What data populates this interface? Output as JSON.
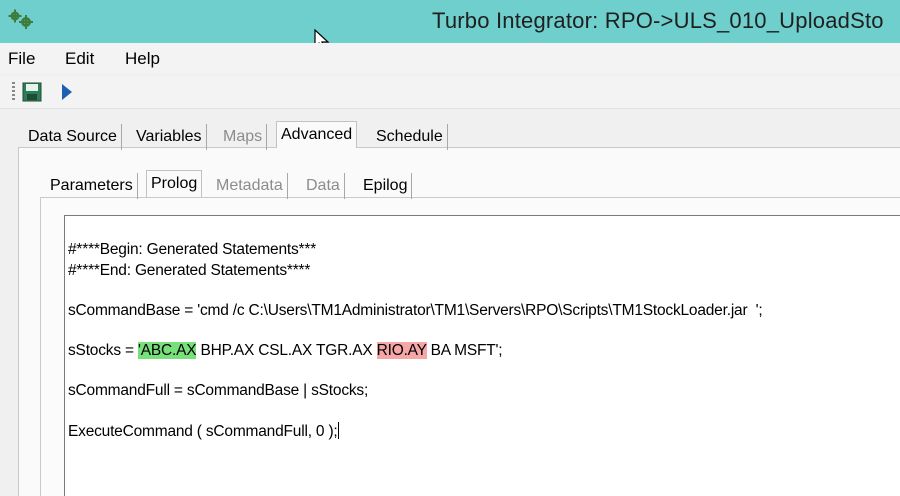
{
  "window": {
    "title": "Turbo Integrator:  RPO->ULS_010_UploadSto",
    "app_icon": "gears-icon",
    "title_bar_color": "#6ecfcd"
  },
  "menu": {
    "file": "File",
    "edit": "Edit",
    "help": "Help"
  },
  "toolbar": {
    "save_icon": "save-icon",
    "run_icon": "run-icon"
  },
  "main_tabs": [
    {
      "label": "Data Source",
      "enabled": true
    },
    {
      "label": "Variables",
      "enabled": true
    },
    {
      "label": "Maps",
      "enabled": false
    },
    {
      "label": "Advanced",
      "enabled": true,
      "active": true
    },
    {
      "label": "Schedule",
      "enabled": true
    }
  ],
  "sub_tabs": [
    {
      "label": "Parameters",
      "enabled": true
    },
    {
      "label": "Prolog",
      "enabled": true,
      "active": true
    },
    {
      "label": "Metadata",
      "enabled": false
    },
    {
      "label": "Data",
      "enabled": false
    },
    {
      "label": "Epilog",
      "enabled": true
    }
  ],
  "code": {
    "line1": "#****Begin: Generated Statements***",
    "line2": "#****End: Generated Statements****",
    "line3": "sCommandBase = 'cmd /c C:\\Users\\TM1Administrator\\TM1\\Servers\\RPO\\Scripts\\TM1StockLoader.jar  ';",
    "line4": {
      "prefix": "sStocks = ",
      "highlight_green": "'ABC.AX",
      "middle": " BHP.AX CSL.AX TGR.AX ",
      "highlight_red": "RIO.AY",
      "suffix": " BA MSFT';"
    },
    "line5": "sCommandFull = sCommandBase | sStocks;",
    "line6": "ExecuteCommand ( sCommandFull, 0 );",
    "highlight_colors": {
      "green": "#78e07a",
      "red": "#f6a6a6"
    }
  }
}
